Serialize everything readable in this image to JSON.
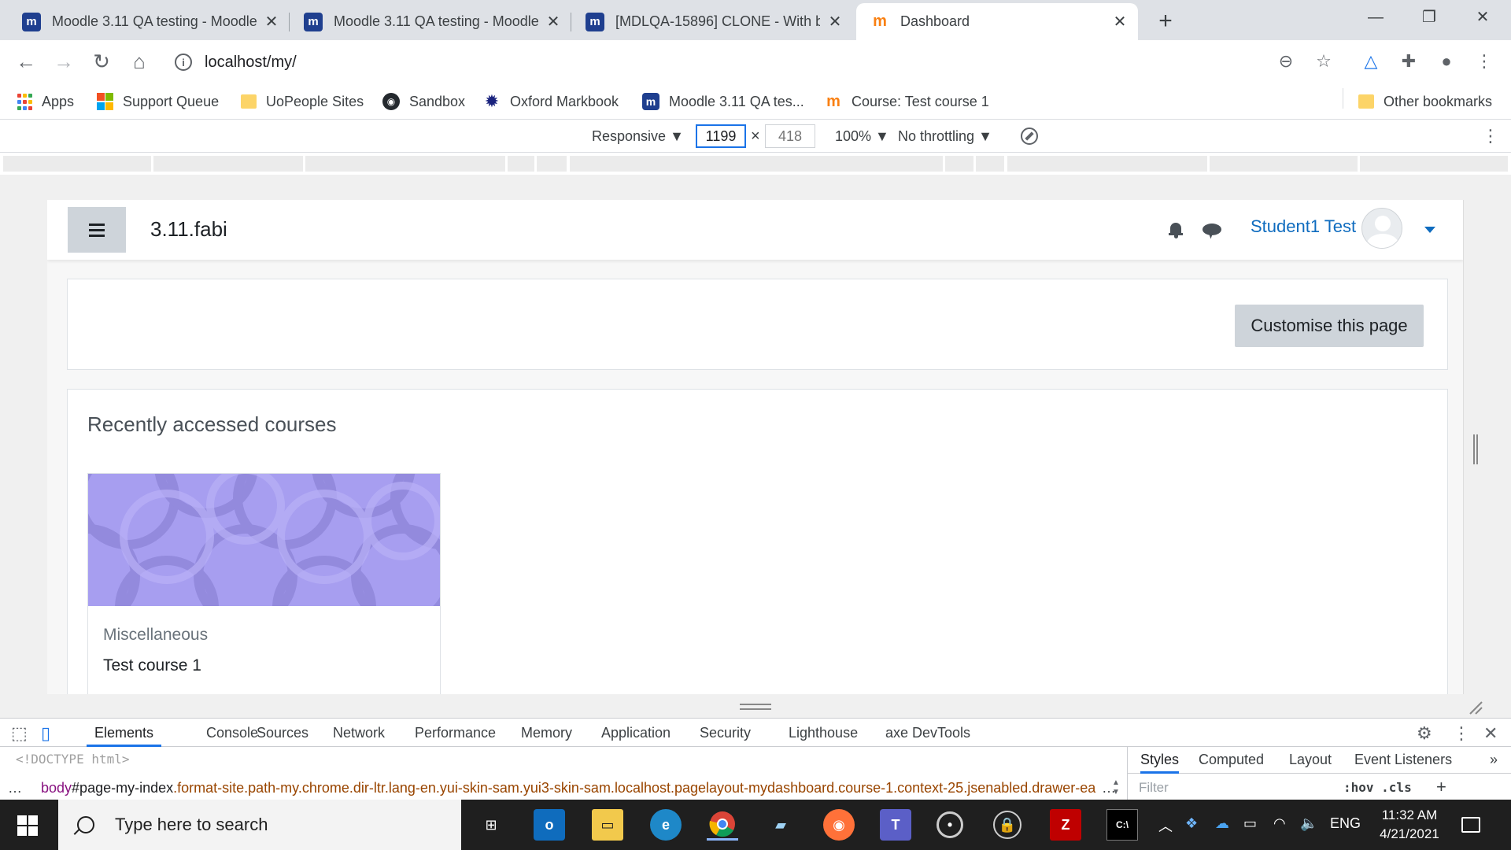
{
  "browser": {
    "tabs": [
      {
        "title": "Moodle 3.11 QA testing - Moodle",
        "favicon": "moodle-icon",
        "active": false
      },
      {
        "title": "Moodle 3.11 QA testing - Moodle",
        "favicon": "moodle-icon",
        "active": false
      },
      {
        "title": "[MDLQA-15896] CLONE - With b",
        "favicon": "moodle-icon",
        "active": false
      },
      {
        "title": "Dashboard",
        "favicon": "moodle-orange-icon",
        "active": true
      }
    ],
    "url": "localhost/my/",
    "bookmarks": [
      {
        "label": "Apps",
        "icon": "apps-grid-icon"
      },
      {
        "label": "Support Queue",
        "icon": "microsoft-icon"
      },
      {
        "label": "UoPeople Sites",
        "icon": "folder-icon"
      },
      {
        "label": "Sandbox",
        "icon": "github-icon"
      },
      {
        "label": "Oxford Markbook",
        "icon": "gear-icon"
      },
      {
        "label": "Moodle 3.11 QA tes...",
        "icon": "moodle-icon"
      },
      {
        "label": "Course: Test course 1",
        "icon": "moodle-orange-icon"
      }
    ],
    "other_bookmarks": "Other bookmarks"
  },
  "device_toolbar": {
    "mode": "Responsive",
    "width": "1199",
    "height": "418",
    "times": "×",
    "zoom": "100%",
    "throttling": "No throttling"
  },
  "page": {
    "site_name": "3.11.fabi",
    "user_name": "Student1 Test",
    "customise_button": "Customise this page",
    "section_title": "Recently accessed courses",
    "courses": [
      {
        "category": "Miscellaneous",
        "name": "Test course 1",
        "image_color": "#a79ef0"
      }
    ]
  },
  "devtools": {
    "tabs": [
      "Elements",
      "Console",
      "Sources",
      "Network",
      "Performance",
      "Memory",
      "Application",
      "Security",
      "Lighthouse",
      "axe DevTools"
    ],
    "active_tab": "Elements",
    "doctype": "<!DOCTYPE html>",
    "breadcrumb_tag": "body",
    "breadcrumb_id": "#page-my-index",
    "breadcrumb_classes": ".format-site.path-my.chrome.dir-ltr.lang-en.yui-skin-sam.yui3-skin-sam.localhost.pagelayout-mydashboard.course-1.context-25.jsenabled.drawer-ea",
    "styles_tabs": [
      "Styles",
      "Computed",
      "Layout",
      "Event Listeners"
    ],
    "filter_placeholder": "Filter",
    "hov_cls": ":hov .cls"
  },
  "taskbar": {
    "search_placeholder": "Type here to search",
    "language": "ENG",
    "time": "11:32 AM",
    "date": "4/21/2021"
  },
  "colors": {
    "moodle_blue": "#0f6cbf",
    "course_image": "#a79ef0",
    "devtools_accent": "#1a73e8"
  }
}
